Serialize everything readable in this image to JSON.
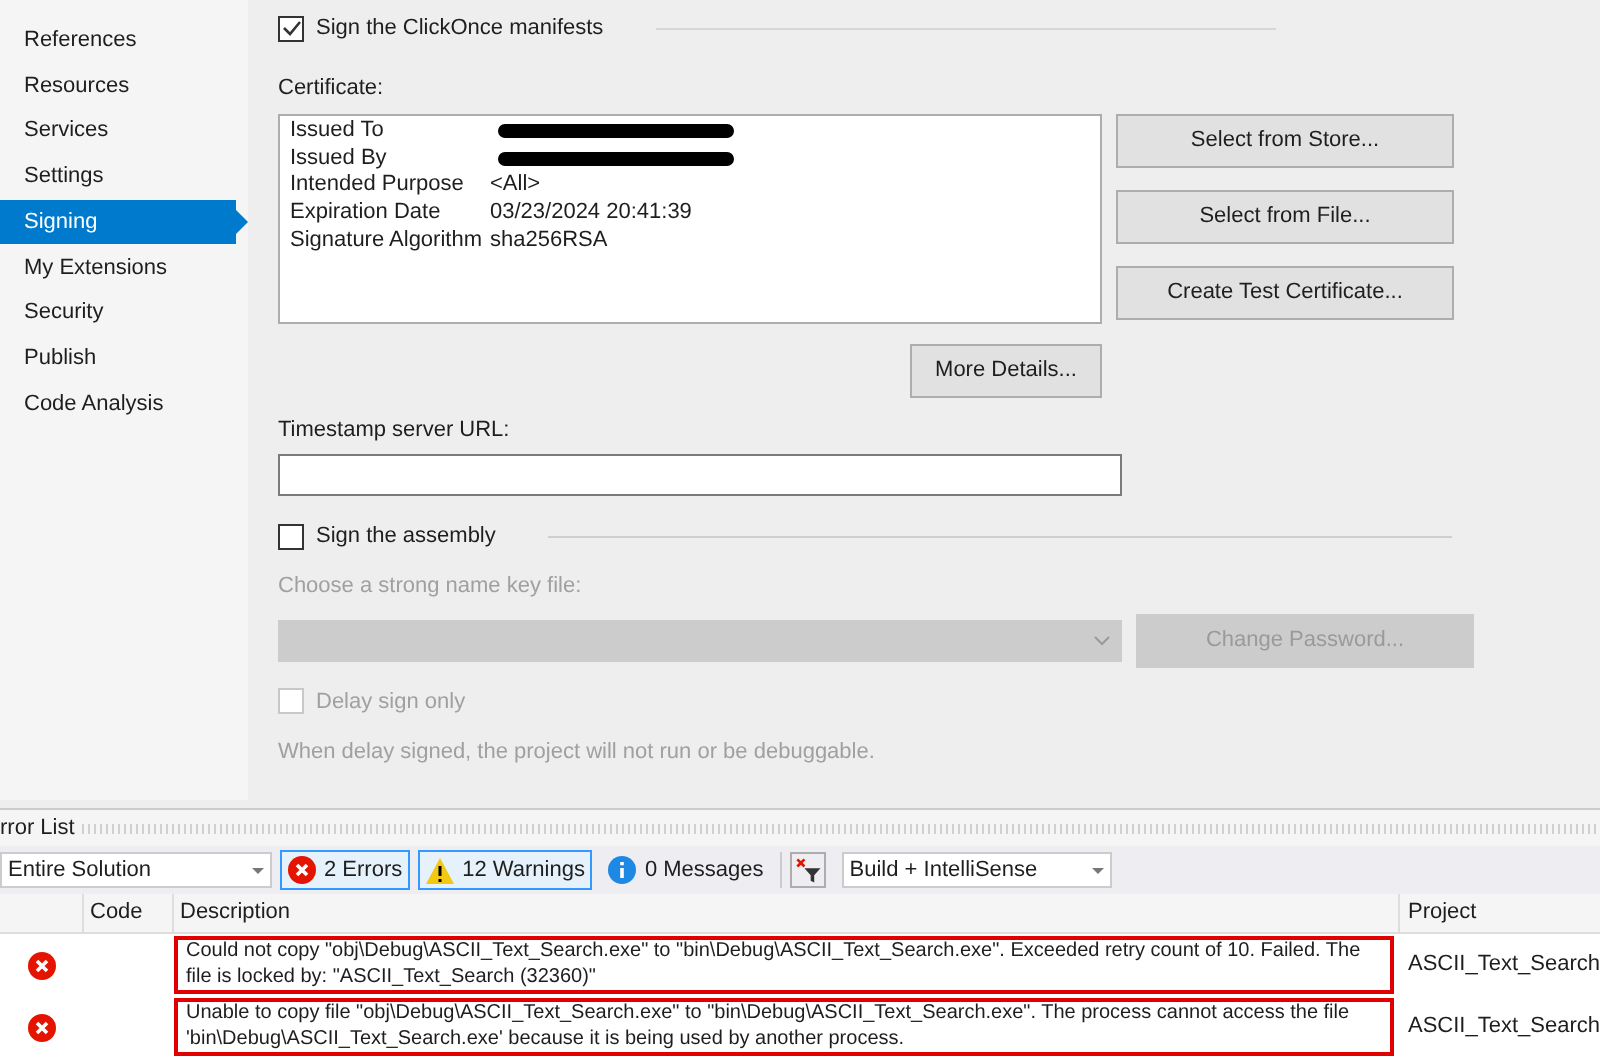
{
  "sidebar": {
    "items": [
      {
        "label": "References",
        "selected": false
      },
      {
        "label": "Resources",
        "selected": false
      },
      {
        "label": "Services",
        "selected": false
      },
      {
        "label": "Settings",
        "selected": false
      },
      {
        "label": "Signing",
        "selected": true
      },
      {
        "label": "My Extensions",
        "selected": false
      },
      {
        "label": "Security",
        "selected": false
      },
      {
        "label": "Publish",
        "selected": false
      },
      {
        "label": "Code Analysis",
        "selected": false
      }
    ]
  },
  "manifests": {
    "label": "Sign the ClickOnce manifests",
    "checked": true
  },
  "certificate": {
    "label": "Certificate:",
    "fields": [
      {
        "name": "Issued To",
        "redacted": true
      },
      {
        "name": "Issued By",
        "redacted": true
      },
      {
        "name": "Intended Purpose",
        "value": "<All>",
        "redacted": false
      },
      {
        "name": "Expiration Date",
        "value": "03/23/2024 20:41:39",
        "redacted": false
      },
      {
        "name": "Signature Algorithm",
        "value": "sha256RSA",
        "redacted": false
      }
    ],
    "buttons": [
      "Select from Store...",
      "Select from File...",
      "Create Test Certificate..."
    ],
    "details_button": "More Details..."
  },
  "timestamp": {
    "label": "Timestamp server URL:"
  },
  "assembly": {
    "label": "Sign the assembly",
    "checked": false,
    "key_file_label": "Choose a strong name key file:",
    "disabled": true,
    "change_password": "Change Password...",
    "delay_sign": {
      "label": "Delay sign only",
      "checked": false
    },
    "note": "When delay signed, the project will not run or be debuggable."
  },
  "error_list": {
    "title": "rror List",
    "scope": "Entire Solution",
    "filters": [
      {
        "kind": "error",
        "label": "2 Errors",
        "selected": true
      },
      {
        "kind": "warning",
        "label": "12 Warnings",
        "selected": true
      },
      {
        "kind": "info",
        "label": "0 Messages",
        "selected": false
      }
    ],
    "source": "Build + IntelliSense",
    "columns": [
      "Code",
      "Description",
      "Project"
    ],
    "rows": [
      {
        "kind": "error",
        "description": "Could not copy \"obj\\Debug\\ASCII_Text_Search.exe\" to \"bin\\Debug\\ASCII_Text_Search.exe\". Exceeded retry count of 10. Failed. The file is locked by: \"ASCII_Text_Search (32360)\"",
        "project": "ASCII_Text_Search",
        "highlighted": true
      },
      {
        "kind": "error",
        "description": "Unable to copy file \"obj\\Debug\\ASCII_Text_Search.exe\" to \"bin\\Debug\\ASCII_Text_Search.exe\". The process cannot access the file 'bin\\Debug\\ASCII_Text_Search.exe' because it is being used by another process.",
        "project": "ASCII_Text_Search",
        "highlighted": true
      }
    ]
  }
}
